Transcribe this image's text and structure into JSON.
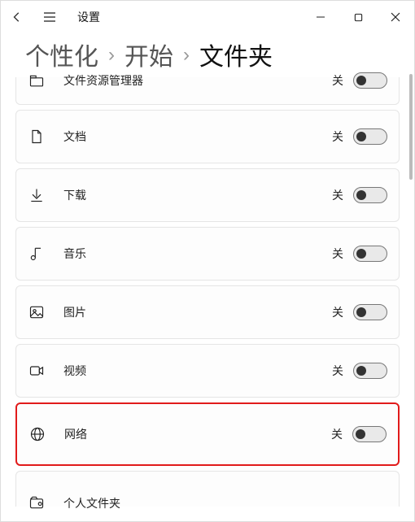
{
  "app": {
    "title": "设置"
  },
  "breadcrumb": {
    "a": "个性化",
    "b": "开始",
    "c": "文件夹",
    "sep": "›"
  },
  "toggle_off_label": "关",
  "items": [
    {
      "id": "file-explorer",
      "label": "文件资源管理器",
      "icon": "file-explorer-icon"
    },
    {
      "id": "documents",
      "label": "文档",
      "icon": "document-icon"
    },
    {
      "id": "downloads",
      "label": "下载",
      "icon": "download-icon"
    },
    {
      "id": "music",
      "label": "音乐",
      "icon": "music-icon"
    },
    {
      "id": "pictures",
      "label": "图片",
      "icon": "picture-icon"
    },
    {
      "id": "videos",
      "label": "视频",
      "icon": "video-icon"
    },
    {
      "id": "network",
      "label": "网络",
      "icon": "network-icon"
    },
    {
      "id": "personal",
      "label": "个人文件夹",
      "icon": "personal-folder-icon"
    }
  ]
}
